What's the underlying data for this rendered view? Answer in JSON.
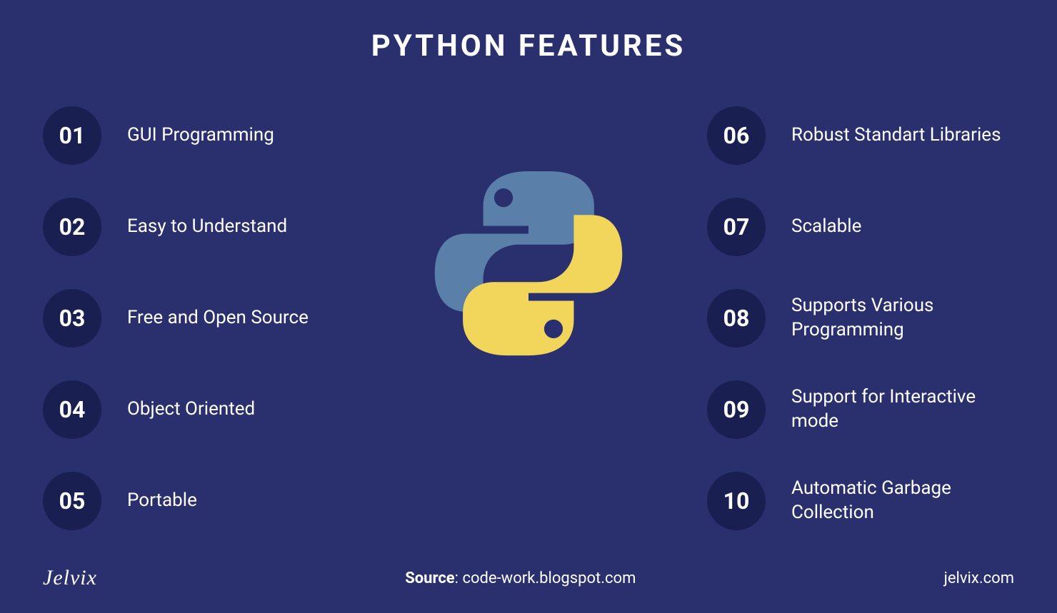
{
  "title": "PYTHON FEATURES",
  "features_left": [
    {
      "num": "01",
      "label": "GUI Programming"
    },
    {
      "num": "02",
      "label": "Easy to Understand"
    },
    {
      "num": "03",
      "label": "Free and Open Source"
    },
    {
      "num": "04",
      "label": "Object Oriented"
    },
    {
      "num": "05",
      "label": "Portable"
    }
  ],
  "features_right": [
    {
      "num": "06",
      "label": "Robust Standart Libraries"
    },
    {
      "num": "07",
      "label": "Scalable"
    },
    {
      "num": "08",
      "label": "Supports Various Programming"
    },
    {
      "num": "09",
      "label": "Support for Interactive mode"
    },
    {
      "num": "10",
      "label": "Automatic Garbage Collection"
    }
  ],
  "footer": {
    "brand": "Jelvix",
    "source_label": "Source",
    "source_text": ": code-work.blogspot.com",
    "url": "jelvix.com"
  },
  "colors": {
    "background": "#2a2f6e",
    "circle": "#1a1f52",
    "text": "#ffffff",
    "python_blue": "#5a7fa8",
    "python_yellow": "#f2d55b"
  }
}
